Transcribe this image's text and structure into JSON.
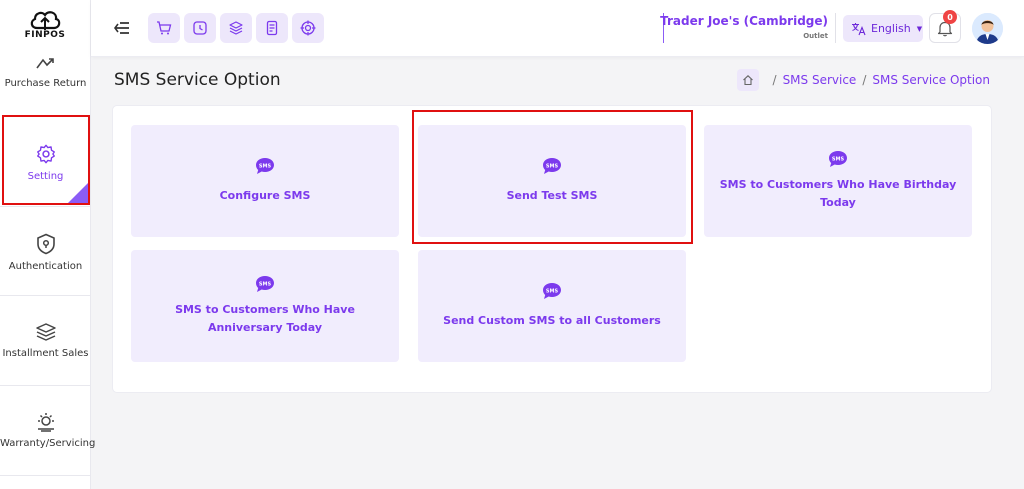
{
  "app": {
    "logo_text": "FINPOS"
  },
  "sidebar": {
    "items": [
      {
        "label": "Purchase Return",
        "icon": "return-arrow-icon"
      },
      {
        "label": "Setting",
        "icon": "gear-icon",
        "active": true
      },
      {
        "label": "Authentication",
        "icon": "shield-lock-icon"
      },
      {
        "label": "Installment Sales",
        "icon": "layers-icon"
      },
      {
        "label": "Warranty/Servicing",
        "icon": "warranty-icon"
      }
    ]
  },
  "header": {
    "quick_actions": [
      "cart-icon",
      "clock-icon",
      "stack-icon",
      "receipt-icon",
      "target-icon"
    ],
    "store_name": "Trader Joe's (Cambridge)",
    "store_type": "Outlet",
    "language": "English",
    "notification_count": "0"
  },
  "page": {
    "title": "SMS Service Option",
    "breadcrumb": [
      "SMS Service",
      "SMS Service Option"
    ],
    "cards": [
      {
        "title": "Configure SMS",
        "icon": "sms-bubble-icon"
      },
      {
        "title": "Send Test SMS",
        "icon": "sms-bubble-icon",
        "highlighted": true
      },
      {
        "title": "SMS to Customers Who Have Birthday Today",
        "icon": "sms-bubble-icon"
      },
      {
        "title": "SMS to Customers Who Have Anniversary Today",
        "icon": "sms-bubble-icon"
      },
      {
        "title": "Send Custom SMS to all Customers",
        "icon": "sms-bubble-icon"
      }
    ],
    "icon_text": "SMS"
  },
  "colors": {
    "accent": "#7c3aed",
    "accent_light": "#f1edfd",
    "highlight": "#e01010",
    "badge": "#ef4444"
  }
}
